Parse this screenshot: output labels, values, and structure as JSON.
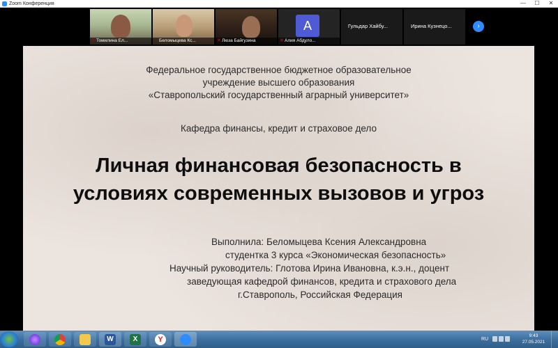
{
  "window": {
    "title": "Zoom Конференция",
    "controls": [
      "—",
      "☐",
      "✕"
    ]
  },
  "participants": [
    {
      "name": "Томилина Ел...",
      "muted": true
    },
    {
      "name": "Беломыцева Кс...",
      "muted": false
    },
    {
      "name": "Люза Байгузина",
      "muted": true
    },
    {
      "name": "Алия Абдуло...",
      "avatar_letter": "A",
      "muted": true
    },
    {
      "name": "Гульдар Хайбу..."
    },
    {
      "name": "Ирина Кузнецо..."
    }
  ],
  "next_label": "›",
  "slide": {
    "institution_lines": [
      "Федеральное государственное бюджетное образовательное",
      "учреждение высшего образования",
      "«Ставропольский государственный аграрный университет»"
    ],
    "department": "Кафедра финансы, кредит и страховое дело",
    "title_lines": [
      "Личная финансовая безопасность в",
      "условиях современных вызовов и угроз"
    ],
    "info_lines": [
      "Выполнила: Беломыцева Ксения Александровна",
      "студентка 3 курса «Экономическая безопасность»",
      "Научный руководитель: Глотова Ирина Ивановна, к.э.н., доцент",
      "заведующая кафедрой финансов, кредита и страхового дела",
      "г.Ставрополь, Российская Федерация"
    ]
  },
  "taskbar": {
    "apps": [
      "start-icon",
      "alice-icon",
      "chrome-icon",
      "file-explorer-icon",
      "word-icon",
      "excel-icon",
      "yandex-browser-icon",
      "zoom-icon"
    ],
    "language": "RU",
    "time": "9:43",
    "date": "27.05.2021"
  },
  "colors": {
    "zoom_blue": "#2d8cff",
    "avatar": "#4f5bd5",
    "slide_bg": "#ece4df",
    "mute_red": "#ff4141"
  }
}
